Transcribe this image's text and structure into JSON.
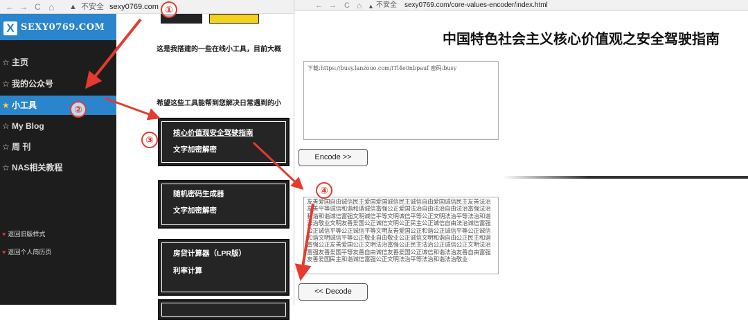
{
  "left_window": {
    "nav_back": "←",
    "nav_forward": "→",
    "nav_reload": "C",
    "nav_home": "⌂",
    "warning_icon": "warning-triangle-icon",
    "security_label": "不安全",
    "url": "sexy0769.com",
    "logo": {
      "mark": "X",
      "text": "SEXY0769.COM"
    },
    "sidebar": {
      "items": [
        {
          "star": "☆",
          "label": "主页"
        },
        {
          "star": "☆",
          "label": "我的公众号"
        },
        {
          "star": "★",
          "label": "小工具"
        },
        {
          "star": "☆",
          "label": "My Blog"
        },
        {
          "star": "☆",
          "label": "周 刊"
        },
        {
          "star": "☆",
          "label": "NAS相关教程"
        }
      ],
      "sub_links": [
        {
          "heart": "♥",
          "label": "返回旧版样式"
        },
        {
          "heart": "♥",
          "label": "返回个人简历页"
        }
      ]
    },
    "content": {
      "intro": "这是我搭建的一些在线小工具，目前大概",
      "hope": "希望这些工具能帮到您解决日常遇到的小",
      "cards": [
        {
          "items": [
            "核心价值观安全驾驶指南",
            "文字加密解密"
          ]
        },
        {
          "items": [
            "随机密码生成器",
            "文字加密解密"
          ]
        },
        {
          "items": [
            "房贷计算器（LPR版）",
            "利率计算"
          ]
        }
      ]
    }
  },
  "right_window": {
    "nav_back": "←",
    "nav_forward": "→",
    "nav_reload": "C",
    "nav_home": "⌂",
    "security_label": "不安全",
    "url": "sexy0769.com/core-values-encoder/index.html",
    "title": "中国特色社会主义核心价值观之安全驾驶指南",
    "input_text": "下载:https://busy.lanzouo.com/iTl4e0nbpauf 密码:busy",
    "encode_button": "Encode >>",
    "output_text": "友善爱国自由诚信民主爱国爱国诚信民主诚信自由爱国诚信民主友善法治友善平等诚信和谐和谐诚信富强公正爱国法治自由法治自由法治富强法治和谐和谐诚信富强文明诚信平等文明诚信平等公正文明法治平等法治和谐法治敬业文明友善爱国公正诚信文明公正民主公正诚信自由法治诚信富强公正诚信平等公正诚信平等文明友善爱国公正和谐公正诚信平等公正诚信和谐文明诚信平等公正敬业自由敬业公正诚信文明和谐自由公正民主和谐富强公正友善爱国公正文明法治富强公正民主法治公正诚信公正文明法治富强友善爱国平等友善自由诚信友善爱国公正诚信和谐法治友善自由富强友善爱国民主和谐诚信富强公正文明法治平等法治和谐法治敬业",
    "decode_button": "<< Decode"
  },
  "annotations": [
    "①",
    "②",
    "③",
    "④"
  ],
  "colors": {
    "accent_blue": "#2a85cc",
    "annotation_red": "#e53a2f",
    "star_yellow": "#ffd43a"
  }
}
